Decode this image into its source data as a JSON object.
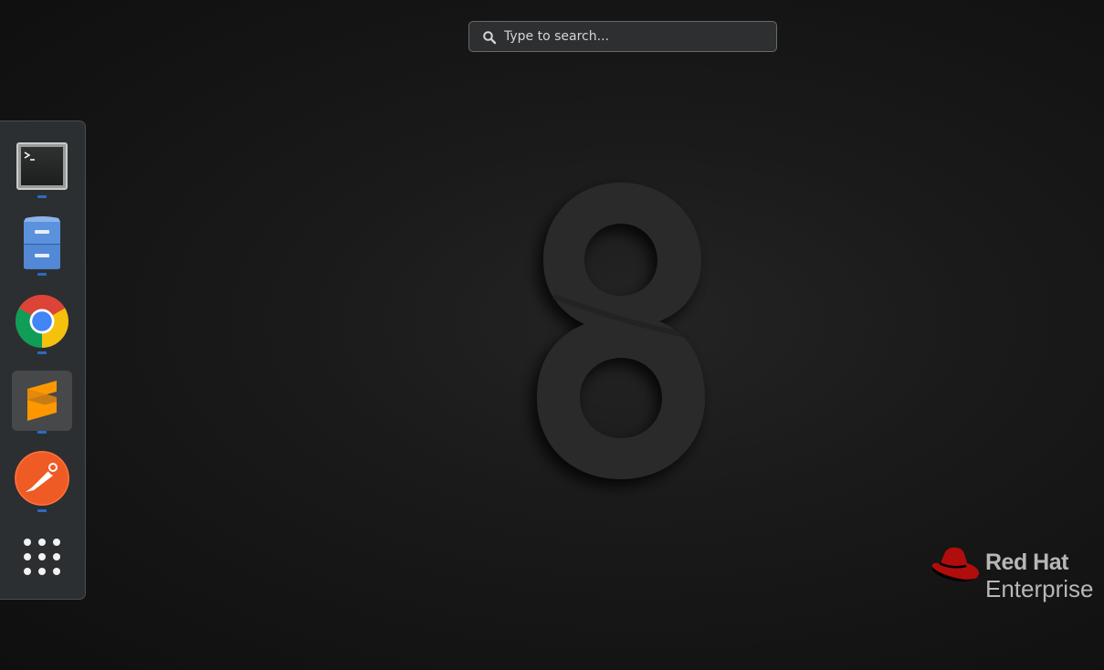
{
  "search": {
    "placeholder": "Type to search...",
    "icon": "search-icon"
  },
  "dash": {
    "items": [
      {
        "name": "terminal",
        "icon": "terminal-icon",
        "running": true
      },
      {
        "name": "files",
        "icon": "file-cabinet-icon",
        "running": true
      },
      {
        "name": "chrome",
        "icon": "chrome-icon",
        "running": true
      },
      {
        "name": "sublime-text",
        "icon": "sublime-text-icon",
        "running": true,
        "active": true
      },
      {
        "name": "postman",
        "icon": "postman-icon",
        "running": true
      },
      {
        "name": "show-applications",
        "icon": "app-grid-icon",
        "running": false
      }
    ],
    "running_indicator_color": "#2b6cc4"
  },
  "wallpaper": {
    "numeral": "8"
  },
  "branding": {
    "name": "Red Hat",
    "product": "Enterprise",
    "hat_color": "#b10d0d"
  }
}
